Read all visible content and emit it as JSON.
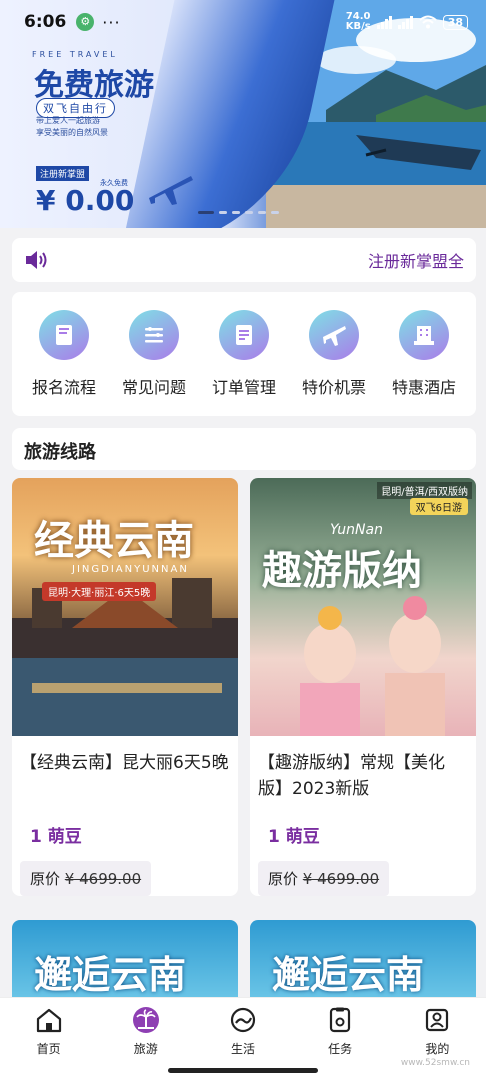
{
  "status": {
    "time": "6:06",
    "badge": "⚙",
    "dots": "···",
    "net_speed_value": "74.0",
    "net_speed_unit": "KB/s",
    "battery": "38"
  },
  "banner": {
    "en": "FREE TRAVEL",
    "title": "免费旅游",
    "subtitle": "双飞自由行",
    "desc1": "带上爱人一起旅游",
    "desc2": "享受美丽的自然风景",
    "register": "注册新掌盟",
    "free": "永久免费",
    "price": "¥ 0.00"
  },
  "notice": {
    "text": "注册新掌盟全"
  },
  "quick_menu": [
    {
      "label": "报名流程",
      "icon": "book-icon"
    },
    {
      "label": "常见问题",
      "icon": "list-icon"
    },
    {
      "label": "订单管理",
      "icon": "document-icon"
    },
    {
      "label": "特价机票",
      "icon": "airplane-icon"
    },
    {
      "label": "特惠酒店",
      "icon": "hotel-icon"
    }
  ],
  "section": {
    "title": "旅游线路"
  },
  "products": [
    {
      "image_text": "经典云南",
      "image_sub": "JINGDIANYUNNAN",
      "image_tag": "昆明·大理·丽江·6天5晚",
      "title": "【经典云南】昆大丽6天5晚",
      "price": "1 萌豆",
      "orig_label": "原价",
      "orig_price": "¥ 4699.00"
    },
    {
      "image_text": "趣游版纳",
      "image_sub": "YunNan",
      "image_tag": "昆明/普洱/西双版纳",
      "image_tag2": "双飞6日游",
      "title": "【趣游版纳】常规【美化版】2023新版",
      "price": "1 萌豆",
      "orig_label": "原价",
      "orig_price": "¥ 4699.00"
    }
  ],
  "more_products": [
    {
      "image_text": "邂逅云南"
    },
    {
      "image_text": "邂逅云南"
    }
  ],
  "tabbar": [
    {
      "label": "首页",
      "icon": "home-icon"
    },
    {
      "label": "旅游",
      "icon": "palm-tree-icon"
    },
    {
      "label": "生活",
      "icon": "life-icon"
    },
    {
      "label": "任务",
      "icon": "task-icon"
    },
    {
      "label": "我的",
      "icon": "profile-icon"
    }
  ],
  "watermark": "www.52smw.cn",
  "colors": {
    "accent": "#7a2ea0",
    "banner_blue": "#1e48a6",
    "icon_gradient_start": "#7fe0e6",
    "icon_gradient_end": "#a97ce8"
  }
}
